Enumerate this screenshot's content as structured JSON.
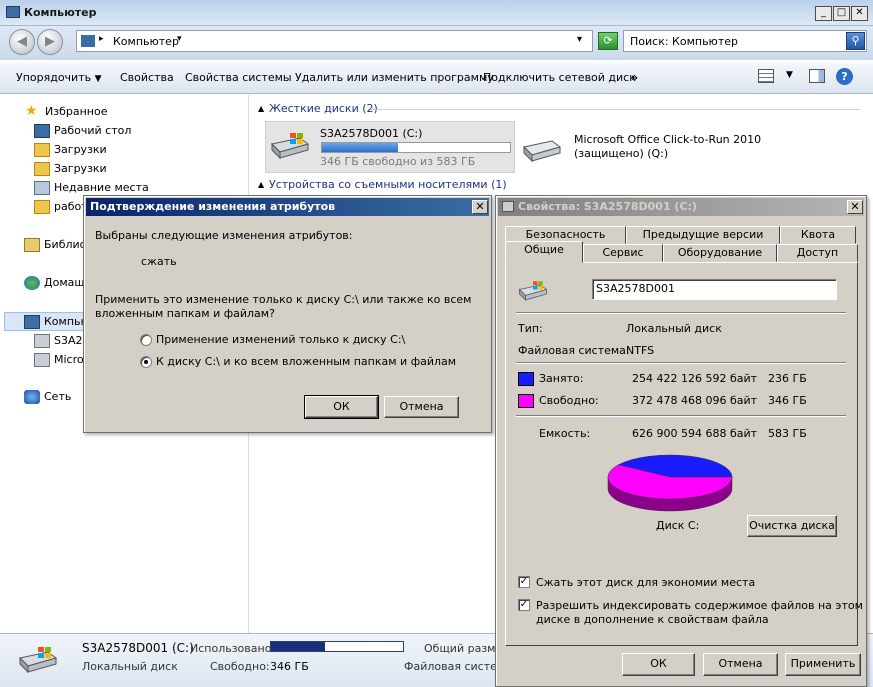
{
  "explorer": {
    "title": "Компьютер",
    "address": {
      "crumb": "Компьютер",
      "search_placeholder": "Поиск: Компьютер"
    },
    "toolbar": {
      "organize": "Упорядочить",
      "properties": "Свойства",
      "system_properties": "Свойства системы",
      "uninstall": "Удалить или изменить программу",
      "map_drive": "Подключить сетевой диск",
      "more": "»"
    },
    "sidebar": {
      "favorites": "Избранное",
      "desktop": "Рабочий стол",
      "downloads1": "Загрузки",
      "downloads2": "Загрузки",
      "recent": "Недавние места",
      "work": "работ",
      "libraries": "Библио",
      "homegroup": "Домашн",
      "computer": "Компью",
      "drive_c": "S3A25",
      "drive_q": "Micros",
      "network": "Сеть"
    },
    "content": {
      "hdd_group": "Жесткие диски (2)",
      "removable_group": "Устройства со съемными носителями (1)",
      "drive_c": {
        "name": "S3A2578D001 (C:)",
        "free_text": "346 ГБ свободно из 583 ГБ",
        "used_fraction": 0.406
      },
      "drive_q": {
        "name": "Microsoft Office Click-to-Run 2010",
        "sub": "(защищено) (Q:)"
      }
    },
    "status": {
      "name": "S3A2578D001 (C:)",
      "used_label": "Использовано:",
      "used_fraction": 0.406,
      "total_label": "Общий размер",
      "type": "Локальный диск",
      "free_label": "Свободно:",
      "free_value": "346 ГБ",
      "fs_label": "Файловая система"
    }
  },
  "confirm": {
    "title": "Подтверждение изменения атрибутов",
    "close": "✕",
    "line1": "Выбраны следующие изменения атрибутов:",
    "attr": "сжать",
    "question_line1": "Применить это изменение только к диску C:\\ или также ко всем",
    "question_line2": "вложенным папкам и файлам?",
    "option1": "Применение изменений только к диску C:\\",
    "option2": "К диску C:\\ и ко всем вложенным папкам и файлам",
    "selected_option": 2,
    "ok": "ОК",
    "cancel": "Отмена"
  },
  "props": {
    "title": "Свойства: S3A2578D001 (C:)",
    "close": "✕",
    "tabs_row1": [
      "Безопасность",
      "Предыдущие версии",
      "Квота"
    ],
    "tabs_row2": [
      "Общие",
      "Сервис",
      "Оборудование",
      "Доступ"
    ],
    "active_tab": "Общие",
    "label_value": "S3A2578D001",
    "type_label": "Тип:",
    "type_value": "Локальный диск",
    "fs_label": "Файловая система:",
    "fs_value": "NTFS",
    "used_label": "Занято:",
    "used_bytes": "254 422 126 592 байт",
    "used_gb": "236 ГБ",
    "free_label": "Свободно:",
    "free_bytes": "372 478 468 096 байт",
    "free_gb": "346 ГБ",
    "capacity_label": "Емкость:",
    "capacity_bytes": "626 900 594 688 байт",
    "capacity_gb": "583 ГБ",
    "disk_label": "Диск C:",
    "cleanup": "Очистка диска",
    "compress_label": "Сжать этот диск для экономии места",
    "compress_checked": true,
    "index_line1": "Разрешить индексировать содержимое файлов на этом",
    "index_line2": "диске в дополнение к свойствам файла",
    "index_checked": true,
    "ok": "ОК",
    "cancel": "Отмена",
    "apply": "Применить",
    "used_fraction": 0.406,
    "colors": {
      "used": "#1a1aff",
      "free": "#ff00ff"
    }
  }
}
